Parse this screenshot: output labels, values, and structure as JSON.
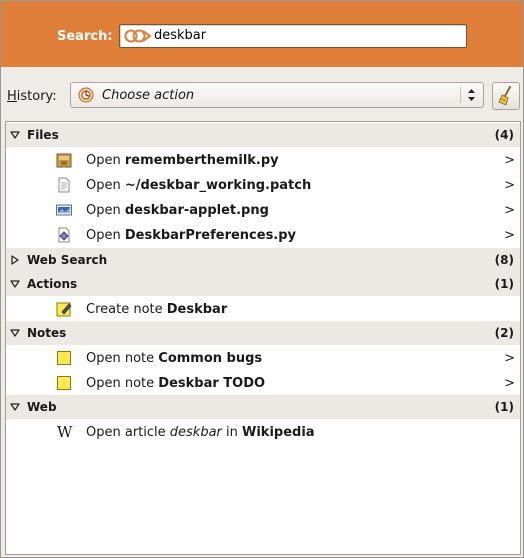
{
  "search": {
    "label": "Search:",
    "value": "deskbar",
    "engine_icon": "deskbar-logo-icon"
  },
  "history": {
    "label_accel": "H",
    "label_rest": "istory:",
    "selected": "Choose action",
    "clear_icon": "broom-icon"
  },
  "categories": {
    "files": {
      "name": "Files",
      "count": "(4)",
      "expanded": true
    },
    "web_search": {
      "name": "Web Search",
      "count": "(8)",
      "expanded": false
    },
    "actions": {
      "name": "Actions",
      "count": "(1)",
      "expanded": true
    },
    "notes": {
      "name": "Notes",
      "count": "(2)",
      "expanded": true
    },
    "web": {
      "name": "Web",
      "count": "(1)",
      "expanded": true
    }
  },
  "items": {
    "files": [
      {
        "verb": "Open ",
        "object": "rememberthemilk.py",
        "more": ">",
        "icon": "python-file-icon"
      },
      {
        "verb": "Open ",
        "object": "~/deskbar_working.patch",
        "more": ">",
        "icon": "text-file-icon"
      },
      {
        "verb": "Open ",
        "object": "deskbar-applet.png",
        "more": ">",
        "icon": "image-file-icon"
      },
      {
        "verb": "Open ",
        "object": "DeskbarPreferences.py",
        "more": ">",
        "icon": "script-file-icon"
      }
    ],
    "actions": [
      {
        "verb": "Create note ",
        "object": "Deskbar",
        "icon": "note-edit-icon"
      }
    ],
    "notes": [
      {
        "verb": "Open note ",
        "object": "Common bugs",
        "more": ">",
        "icon": "note-icon"
      },
      {
        "verb": "Open note ",
        "object": "Deskbar TODO",
        "more": ">",
        "icon": "note-icon"
      }
    ],
    "web": [
      {
        "verb": "Open article ",
        "query": "deskbar",
        "mid": " in ",
        "object": "Wikipedia",
        "icon_glyph": "W",
        "icon": "wikipedia-icon"
      }
    ]
  },
  "colors": {
    "banner": "#e07f3a",
    "category_bg": "#ece8e3",
    "window_bg": "#efebe7"
  }
}
